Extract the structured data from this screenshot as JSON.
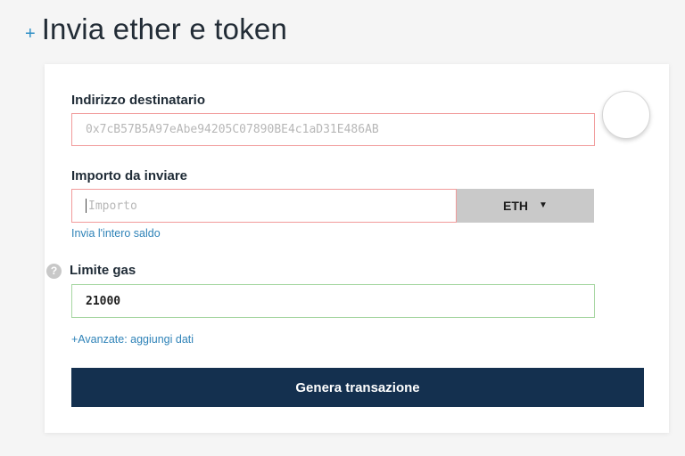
{
  "header": {
    "plus": "+",
    "title": "Invia ether e token"
  },
  "form": {
    "recipient": {
      "label": "Indirizzo destinatario",
      "placeholder": "0x7cB57B5A97eAbe94205C07890BE4c1aD31E486AB"
    },
    "amount": {
      "label": "Importo da inviare",
      "placeholder": "Importo",
      "currency": "ETH",
      "send_all_link": "Invia l'intero saldo"
    },
    "gas": {
      "help": "?",
      "label": "Limite gas",
      "value": "21000"
    },
    "advanced_link": "+Avanzate: aggiungi dati",
    "submit_label": "Genera transazione"
  },
  "icons": {
    "caret": "chevron-down-icon",
    "help": "question-circle-icon",
    "avatar": "identicon-icon"
  },
  "colors": {
    "accent": "#2f83b8",
    "button_bg": "#14304f",
    "error_border": "#f19b9b",
    "success_border": "#a6d6a1"
  }
}
